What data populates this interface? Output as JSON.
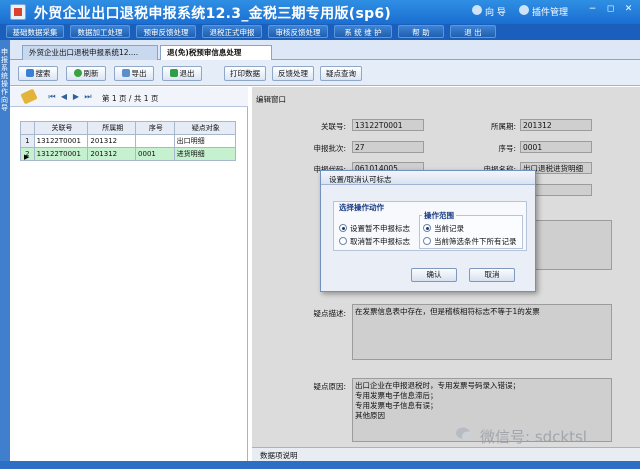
{
  "app": {
    "title": "外贸企业出口退税申报系统12.3_金税三期专用版(sp6)",
    "guide_label": "向 导",
    "plugin_label": "插件管理"
  },
  "menu": [
    "基础数据采集",
    "数据加工处理",
    "预审反馈处理",
    "退税正式申报",
    "审核反馈处理",
    "系 统 维 护",
    "帮 助",
    "退 出"
  ],
  "sidebar_label": "申报系统操作向导",
  "tabs": [
    {
      "label": "外贸企业出口退税申报系统12...."
    },
    {
      "label": "退(免)税预审信息处理"
    }
  ],
  "toolbar": {
    "search": "搜索",
    "refresh": "刷新",
    "export": "导出",
    "exit": "退出",
    "print": "打印数据",
    "feedback": "反馈处理",
    "doubt_query": "疑点查询"
  },
  "pager": {
    "text": "第 1 页 / 共 1 页"
  },
  "grid": {
    "columns": [
      "关联号",
      "所属期",
      "序号",
      "疑点对象"
    ],
    "rows": [
      {
        "num": "1",
        "cells": [
          "13122T0001",
          "201312",
          "",
          "出口明细"
        ]
      },
      {
        "num": "2",
        "cells": [
          "13122T0001",
          "201312",
          "0001",
          "进货明细"
        ]
      }
    ]
  },
  "edit_window": {
    "label": "编辑窗口",
    "fields": {
      "link_no_label": "关联号:",
      "link_no": "13122T0001",
      "period_label": "所属期:",
      "period": "201312",
      "batch_label": "申报批次:",
      "batch": "27",
      "seq_label": "序号:",
      "seq": "0001",
      "code_label": "申报代码:",
      "code": "061014005",
      "name_label": "申报名称:",
      "name": "出口退税进货明细",
      "doubt_desc_label": "疑点描述:",
      "doubt_desc": "在发票信息表中存在，但是稽核相符标志不等于1的发票",
      "doubt_reason_label": "疑点原因:",
      "doubt_reason": "出口企业在申报退税时，专用发票号码录入错误；\n专用发票电子信息滞后；\n专用发票电子信息有误；\n其他原因"
    },
    "bottom_tab": "数据项说明"
  },
  "dialog": {
    "title": "设置/取消认可标志",
    "action_group": "选择操作动作",
    "action_options": [
      "设置暂不申报标志",
      "取消暂不申报标志"
    ],
    "range_group": "操作范围",
    "range_options": [
      "当前记录",
      "当前筛选条件下所有记录"
    ],
    "confirm": "确认",
    "cancel": "取消"
  },
  "watermark": "微信号: sdcktsl"
}
